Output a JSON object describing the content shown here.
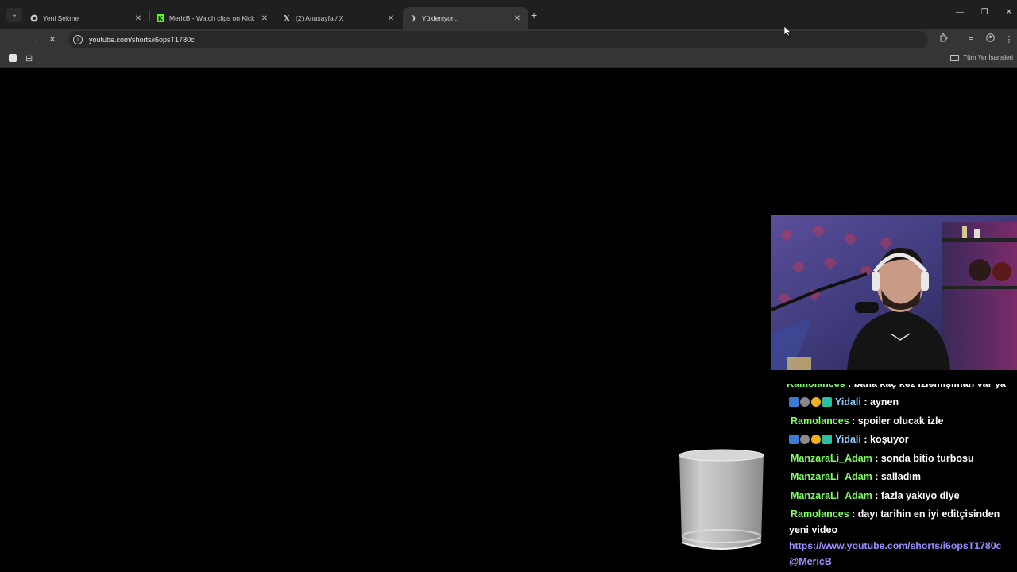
{
  "browser": {
    "tabs": [
      {
        "title": "Yeni Sekme",
        "icon": "chrome-icon",
        "active": false
      },
      {
        "title": "MericB - Watch clips on Kick",
        "icon": "kick-icon",
        "active": false
      },
      {
        "title": "(2) Anasayfa / X",
        "icon": "x-icon",
        "active": false
      },
      {
        "title": "Yükleniyor...",
        "icon": "loading-icon",
        "active": true
      }
    ],
    "url": "youtube.com/shorts/i6opsT1780c",
    "bookmarks_all": "Tüm Yer İşaretleri"
  },
  "chat": {
    "messages": [
      {
        "user": "Ramolances",
        "text": " : bana kaç kez izlemişiman var ya",
        "badges": false,
        "user_color": "#7dff5f"
      },
      {
        "user": "Yidali",
        "text": " : aynen",
        "badges": true,
        "user_color": "#8fd1ff"
      },
      {
        "user": "Ramolances",
        "text": " : spoiler olucak izle",
        "badges": false,
        "user_color": "#7dff5f"
      },
      {
        "user": "Yidali",
        "text": " : koşuyor",
        "badges": true,
        "user_color": "#8fd1ff"
      },
      {
        "user": "ManzaraLi_Adam",
        "text": " : sonda bitio turbosu",
        "badges": false,
        "user_color": "#7dff5f"
      },
      {
        "user": "ManzaraLi_Adam",
        "text": " : salladım",
        "badges": false,
        "user_color": "#7dff5f"
      },
      {
        "user": "ManzaraLi_Adam",
        "text": " : fazla yakıyo diye",
        "badges": false,
        "user_color": "#7dff5f"
      },
      {
        "user": "Ramolances",
        "text": " : dayı tarihin en iyi editçisinden",
        "badges": false,
        "user_color": "#7dff5f"
      }
    ],
    "continuation": "yeni video",
    "link": "https://www.youtube.com/shorts/i6opsT1780c",
    "mention": "@MericB"
  },
  "colors": {
    "link": "#9d8dff",
    "nick_green": "#7dff5f",
    "nick_blue": "#8fd1ff"
  }
}
